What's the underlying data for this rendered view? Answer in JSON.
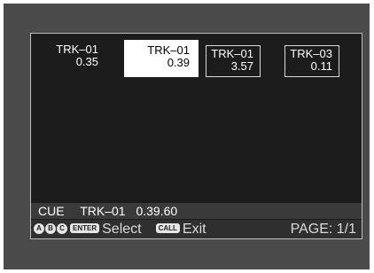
{
  "tracks": [
    {
      "name": "TRK–01",
      "time": "0.35",
      "selected": false
    },
    {
      "name": "TRK–01",
      "time": "0.39",
      "selected": true
    },
    {
      "name": "TRK–01",
      "time": "3.57",
      "selected": false
    },
    {
      "name": "TRK–03",
      "time": "0.11",
      "selected": false
    }
  ],
  "status": {
    "mode": "CUE",
    "track": "TRK–01",
    "position": "0.39.60"
  },
  "help": {
    "keys": [
      "A",
      "B",
      "C"
    ],
    "enter_key": "ENTER",
    "select_label": "Select",
    "call_key": "CALL",
    "exit_label": "Exit",
    "page_label": "PAGE: 1/1"
  },
  "colors": {
    "bezel": "#4a4a4a",
    "screen_bg": "#1c1c1c",
    "selected_bg": "#ffffff"
  }
}
